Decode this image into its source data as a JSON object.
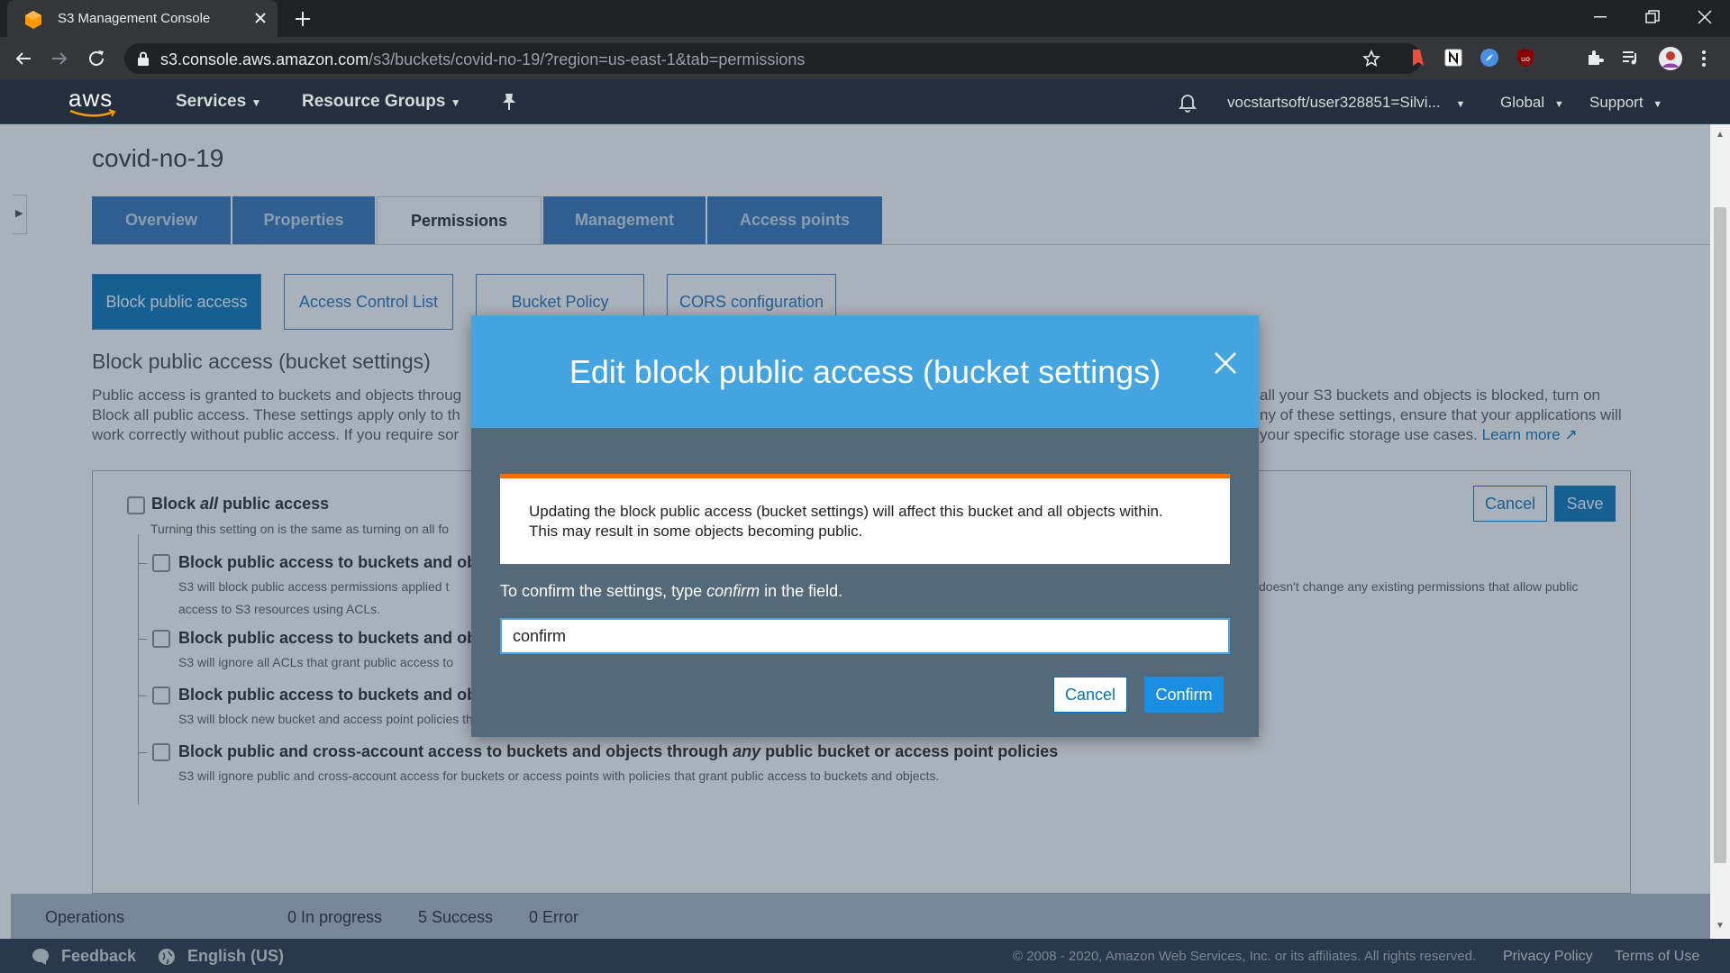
{
  "browser": {
    "tab_title": "S3 Management Console",
    "url_host": "s3.console.aws.amazon.com",
    "url_path": "/s3/buckets/covid-no-19/?region=us-east-1&tab=permissions"
  },
  "aws_nav": {
    "logo": "aws",
    "services": "Services",
    "resource_groups": "Resource Groups",
    "account": "vocstartsoft/user328851=Silvi...",
    "region": "Global",
    "support": "Support"
  },
  "bucket": {
    "name": "covid-no-19"
  },
  "tabs": [
    {
      "label": "Overview"
    },
    {
      "label": "Properties"
    },
    {
      "label": "Permissions",
      "active": true
    },
    {
      "label": "Management"
    },
    {
      "label": "Access points"
    }
  ],
  "subtabs": [
    {
      "label": "Block public access",
      "active": true
    },
    {
      "label": "Access Control List"
    },
    {
      "label": "Bucket Policy"
    },
    {
      "label": "CORS configuration"
    }
  ],
  "section": {
    "title": "Block public access (bucket settings)",
    "desc_left_1": "Public access is granted to buckets and objects throug",
    "desc_left_2": "Block all public access. These settings apply only to th",
    "desc_left_3": "work correctly without public access. If you require sor",
    "desc_right_1": "all your S3 buckets and objects is blocked, turn on",
    "desc_right_2": "ny of these settings, ensure that your applications will",
    "desc_right_3": "your specific storage use cases.",
    "learn_more": "Learn more"
  },
  "settings": {
    "cancel": "Cancel",
    "save": "Save",
    "block_all_prefix": "Block ",
    "block_all_em": "all",
    "block_all_suffix": " public access",
    "block_all_desc": "Turning this setting on is the same as turning on all fo",
    "options": [
      {
        "title": "Block public access to buckets and obj",
        "desc": "S3 will block public access permissions applied t",
        "desc2": "access to S3 resources using ACLs.",
        "desc_right": "doesn't change any existing permissions that allow public"
      },
      {
        "title": "Block public access to buckets and obj",
        "desc": "S3 will ignore all ACLs that grant public access to"
      },
      {
        "title": "Block public access to buckets and objects granted through new public bucket or access point policies",
        "desc": "S3 will block new bucket and access point policies that grant public access to buckets and objects. This setting doesn't change any existing policies that allow public access to S3 resources."
      },
      {
        "title_prefix": "Block public and cross-account access to buckets and objects through ",
        "title_em": "any",
        "title_suffix": " public bucket or access point policies",
        "desc": "S3 will ignore public and cross-account access for buckets or access points with policies that grant public access to buckets and objects."
      }
    ]
  },
  "operations": {
    "label": "Operations",
    "in_progress": "0 In progress",
    "success": "5 Success",
    "error": "0 Error"
  },
  "footer": {
    "feedback": "Feedback",
    "language": "English (US)",
    "copyright": "© 2008 - 2020, Amazon Web Services, Inc. or its affiliates. All rights reserved.",
    "privacy": "Privacy Policy",
    "terms": "Terms of Use"
  },
  "modal": {
    "title": "Edit block public access (bucket settings)",
    "warning_line1": "Updating the block public access (bucket settings) will affect this bucket and all objects within.",
    "warning_line2": "This may result in some objects becoming public.",
    "confirm_prefix": "To confirm the settings, type ",
    "confirm_em": "confirm",
    "confirm_suffix": " in the field.",
    "input_value": "confirm",
    "cancel": "Cancel",
    "confirm": "Confirm"
  },
  "colors": {
    "aws_nav": "#232f3e",
    "primary": "#0073bb",
    "modal_header": "#44a4e0",
    "warning_accent": "#ec7211"
  }
}
